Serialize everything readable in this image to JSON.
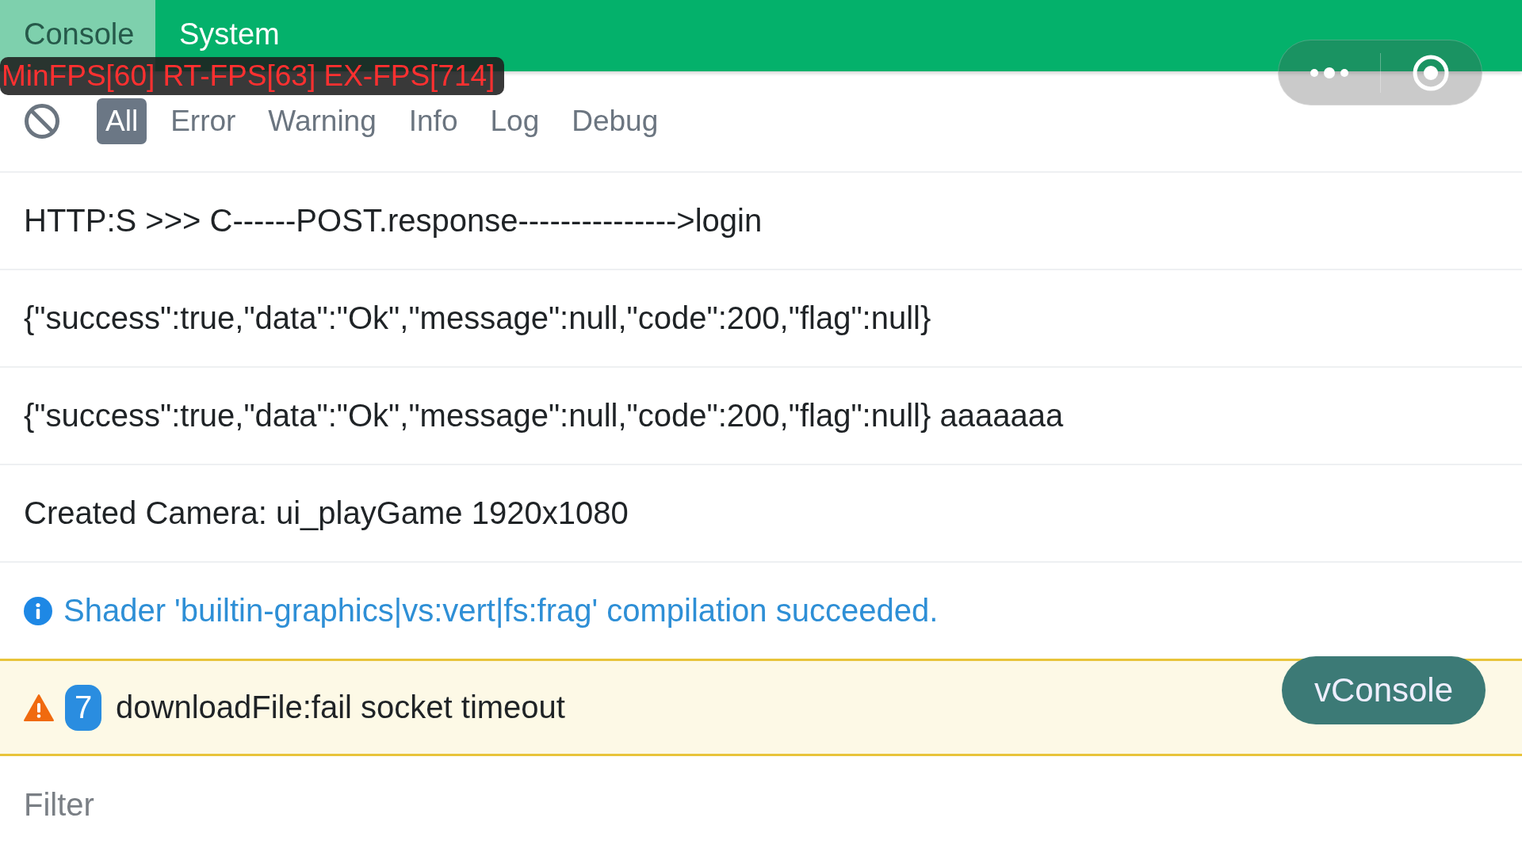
{
  "tabs": [
    {
      "label": "Console",
      "selected": true
    },
    {
      "label": "System",
      "selected": false
    }
  ],
  "fps_overlay": {
    "text": "MinFPS[60] RT-FPS[63] EX-FPS[714]"
  },
  "toolbar": {
    "filters": [
      {
        "label": "All",
        "selected": true
      },
      {
        "label": "Error",
        "selected": false
      },
      {
        "label": "Warning",
        "selected": false
      },
      {
        "label": "Info",
        "selected": false
      },
      {
        "label": "Log",
        "selected": false
      },
      {
        "label": "Debug",
        "selected": false
      }
    ]
  },
  "logs": [
    {
      "kind": "log",
      "text": "HTTP:S >>> C------POST.response--------------->login"
    },
    {
      "kind": "log",
      "text": "{\"success\":true,\"data\":\"Ok\",\"message\":null,\"code\":200,\"flag\":null}"
    },
    {
      "kind": "log",
      "text": "{\"success\":true,\"data\":\"Ok\",\"message\":null,\"code\":200,\"flag\":null} aaaaaaa"
    },
    {
      "kind": "log",
      "text": "Created Camera: ui_playGame 1920x1080"
    },
    {
      "kind": "info",
      "text": "Shader 'builtin-graphics|vs:vert|fs:frag' compilation succeeded."
    },
    {
      "kind": "warn",
      "count": "7",
      "text": "downloadFile:fail socket timeout"
    }
  ],
  "filter_input": {
    "placeholder": "Filter"
  },
  "floating_button": {
    "label": "vConsole"
  }
}
